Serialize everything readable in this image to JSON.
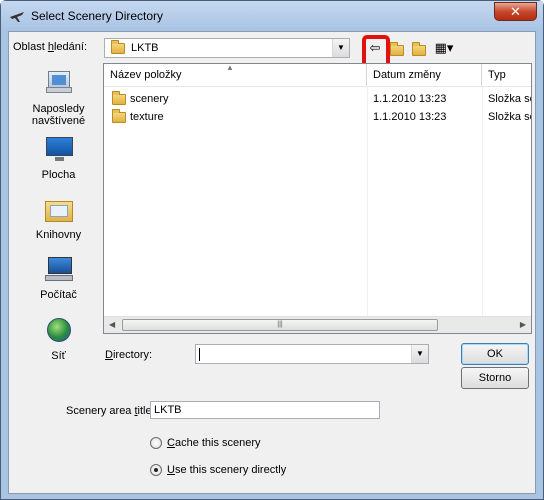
{
  "window": {
    "title": "Select Scenery Directory",
    "close_label": "✕"
  },
  "lookin": {
    "label_pre": "Oblast ",
    "label_key": "h",
    "label_post": "ledání:",
    "value": "LKTB"
  },
  "toolbar": {
    "back_glyph": "⇦",
    "up_glyph": "⇪",
    "newfolder_glyph": "✱",
    "views_glyph": "▦▾"
  },
  "places": [
    {
      "line1": "Naposledy",
      "line2": "navštívené"
    },
    {
      "line1": "Plocha",
      "line2": ""
    },
    {
      "line1": "Knihovny",
      "line2": ""
    },
    {
      "line1": "Počítač",
      "line2": ""
    },
    {
      "line1": "Síť",
      "line2": ""
    }
  ],
  "filelist": {
    "columns": [
      "Název položky",
      "Datum změny",
      "Typ"
    ],
    "rows": [
      {
        "name": "scenery",
        "date": "1.1.2010 13:23",
        "type": "Složka sou"
      },
      {
        "name": "texture",
        "date": "1.1.2010 13:23",
        "type": "Složka sou"
      }
    ]
  },
  "directory": {
    "label_key": "D",
    "label_post": "irectory:",
    "value": ""
  },
  "buttons": {
    "ok": "OK",
    "cancel": "Storno"
  },
  "scenery_title": {
    "label_pre": "Scenery area ",
    "label_key": "t",
    "label_post": "itle:",
    "value": "LKTB"
  },
  "options": {
    "cache": {
      "key": "C",
      "rest": "ache this scenery",
      "checked": false
    },
    "direct": {
      "key": "U",
      "rest": "se this scenery directly",
      "checked": true
    }
  }
}
